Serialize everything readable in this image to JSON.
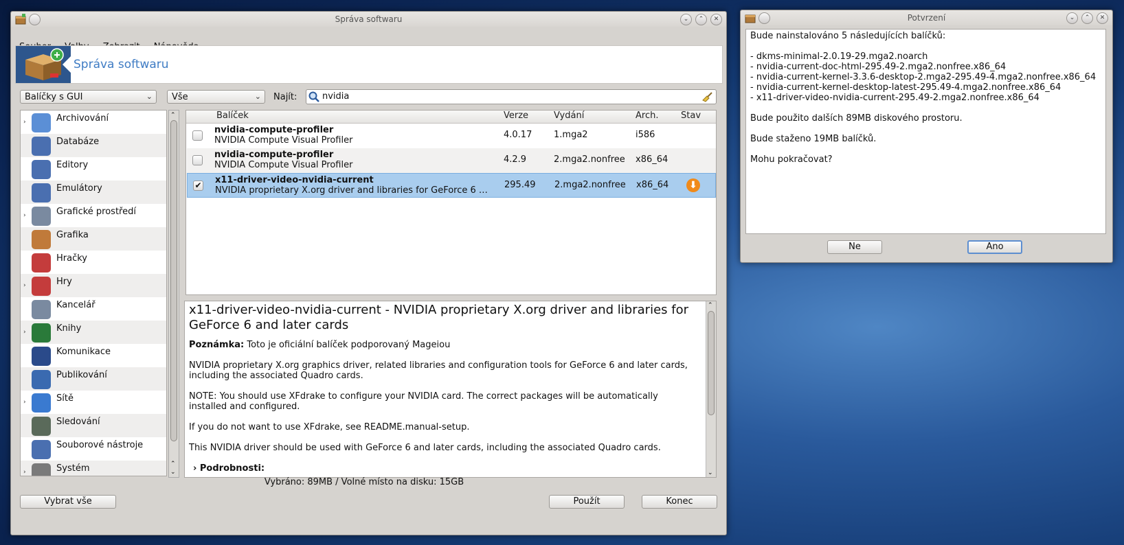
{
  "main_window": {
    "title": "Správa softwaru",
    "menu": [
      "Soubor",
      "Volby",
      "Zobrazit",
      "Nápověda"
    ],
    "banner_title": "Správa softwaru",
    "filter_combo": "Balíčky s GUI",
    "scope_combo": "Vše",
    "find_label": "Najít:",
    "search_value": "nvidia",
    "categories": [
      {
        "label": "Archivování",
        "icon": "archive-icon",
        "expandable": true
      },
      {
        "label": "Databáze",
        "icon": "database-icon",
        "expandable": false
      },
      {
        "label": "Editory",
        "icon": "editor-icon",
        "expandable": false
      },
      {
        "label": "Emulátory",
        "icon": "emulator-icon",
        "expandable": false
      },
      {
        "label": "Grafické prostředí",
        "icon": "desktop-icon",
        "expandable": true
      },
      {
        "label": "Grafika",
        "icon": "palette-icon",
        "expandable": false
      },
      {
        "label": "Hračky",
        "icon": "cards-icon",
        "expandable": false
      },
      {
        "label": "Hry",
        "icon": "games-icon",
        "expandable": true
      },
      {
        "label": "Kancelář",
        "icon": "office-icon",
        "expandable": false
      },
      {
        "label": "Knihy",
        "icon": "book-icon",
        "expandable": true
      },
      {
        "label": "Komunikace",
        "icon": "communication-icon",
        "expandable": false
      },
      {
        "label": "Publikování",
        "icon": "publishing-icon",
        "expandable": false
      },
      {
        "label": "Sítě",
        "icon": "network-icon",
        "expandable": true
      },
      {
        "label": "Sledování",
        "icon": "monitoring-icon",
        "expandable": false
      },
      {
        "label": "Souborové nástroje",
        "icon": "file-tools-icon",
        "expandable": false
      },
      {
        "label": "Systém",
        "icon": "system-tools-icon",
        "expandable": true
      }
    ],
    "columns": {
      "package": "Balíček",
      "version": "Verze",
      "release": "Vydání",
      "arch": "Arch.",
      "status": "Stav"
    },
    "packages": [
      {
        "name": "nvidia-compute-profiler",
        "summary": "NVIDIA Compute Visual Profiler",
        "version": "4.0.17",
        "release": "1.mga2",
        "arch": "i586",
        "checked": false
      },
      {
        "name": "nvidia-compute-profiler",
        "summary": "NVIDIA Compute Visual Profiler",
        "version": "4.2.9",
        "release": "2.mga2.nonfree",
        "arch": "x86_64",
        "checked": false
      },
      {
        "name": "x11-driver-video-nvidia-current",
        "summary": "NVIDIA proprietary X.org driver and libraries for GeForce 6 and later cards",
        "version": "295.49",
        "release": "2.mga2.nonfree",
        "arch": "x86_64",
        "checked": true,
        "status_icon": "download-icon"
      }
    ],
    "detail": {
      "heading": "x11-driver-video-nvidia-current - NVIDIA proprietary X.org driver and libraries for GeForce 6 and later cards",
      "note_label": "Poznámka:",
      "note_text": "Toto je oficiální balíček podporovaný Mageiou",
      "paragraphs": [
        "NVIDIA proprietary X.org graphics driver, related libraries and configuration tools for GeForce 6 and later cards, including the associated Quadro cards.",
        "NOTE: You should use XFdrake to configure your NVIDIA card. The correct packages will be automatically installed and configured.",
        "If you do not want to use XFdrake, see README.manual-setup.",
        "This NVIDIA driver should be used with GeForce 6 and later cards, including the associated Quadro cards."
      ],
      "details_label": "Podrobnosti:"
    },
    "status": "Vybráno: 89MB / Volné místo na disku: 15GB",
    "buttons": {
      "select_all": "Vybrat vše",
      "apply": "Použít",
      "quit": "Konec"
    }
  },
  "dialog": {
    "title": "Potvrzení",
    "lines": [
      "Bude nainstalováno 5 následujících balíčků:",
      "",
      "- dkms-minimal-2.0.19-29.mga2.noarch",
      "- nvidia-current-doc-html-295.49-2.mga2.nonfree.x86_64",
      "- nvidia-current-kernel-3.3.6-desktop-2.mga2-295.49-4.mga2.nonfree.x86_64",
      "- nvidia-current-kernel-desktop-latest-295.49-4.mga2.nonfree.x86_64",
      "- x11-driver-video-nvidia-current-295.49-2.mga2.nonfree.x86_64",
      "",
      "Bude použito dalších 89MB diskového prostoru.",
      "",
      "Bude staženo 19MB balíčků.",
      "",
      "Mohu pokračovat?"
    ],
    "no_label": "Ne",
    "yes_label": "Ano"
  }
}
